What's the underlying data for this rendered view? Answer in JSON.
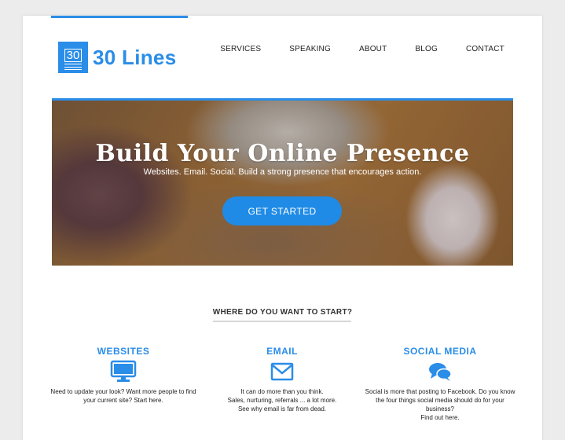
{
  "brand": {
    "logo_number": "30",
    "name": "30 Lines"
  },
  "nav": {
    "items": [
      "SERVICES",
      "SPEAKING",
      "ABOUT",
      "BLOG",
      "CONTACT"
    ]
  },
  "hero": {
    "title": "Build Your Online Presence",
    "subtitle": "Websites. Email. Social. Build a strong presence that encourages action.",
    "cta_label": "GET STARTED"
  },
  "section": {
    "heading": "WHERE DO YOU WANT TO START?"
  },
  "features": [
    {
      "title": "WEBSITES",
      "icon": "monitor-icon",
      "lines": [
        "Need to update your look? Want more people to find",
        "your current site? Start here."
      ]
    },
    {
      "title": "EMAIL",
      "icon": "envelope-icon",
      "lines": [
        "It can do more than you think.",
        "Sales, nurturing, referrals ... a lot more.",
        "See why email is far from dead."
      ]
    },
    {
      "title": "SOCIAL MEDIA",
      "icon": "chat-bubbles-icon",
      "lines": [
        "Social is more that posting to Facebook. Do you know",
        "the four things social media should do for your",
        "business?",
        "Find out here."
      ]
    }
  ],
  "colors": {
    "accent": "#2a8de8",
    "button": "#1f8be6",
    "background": "#ececec"
  }
}
